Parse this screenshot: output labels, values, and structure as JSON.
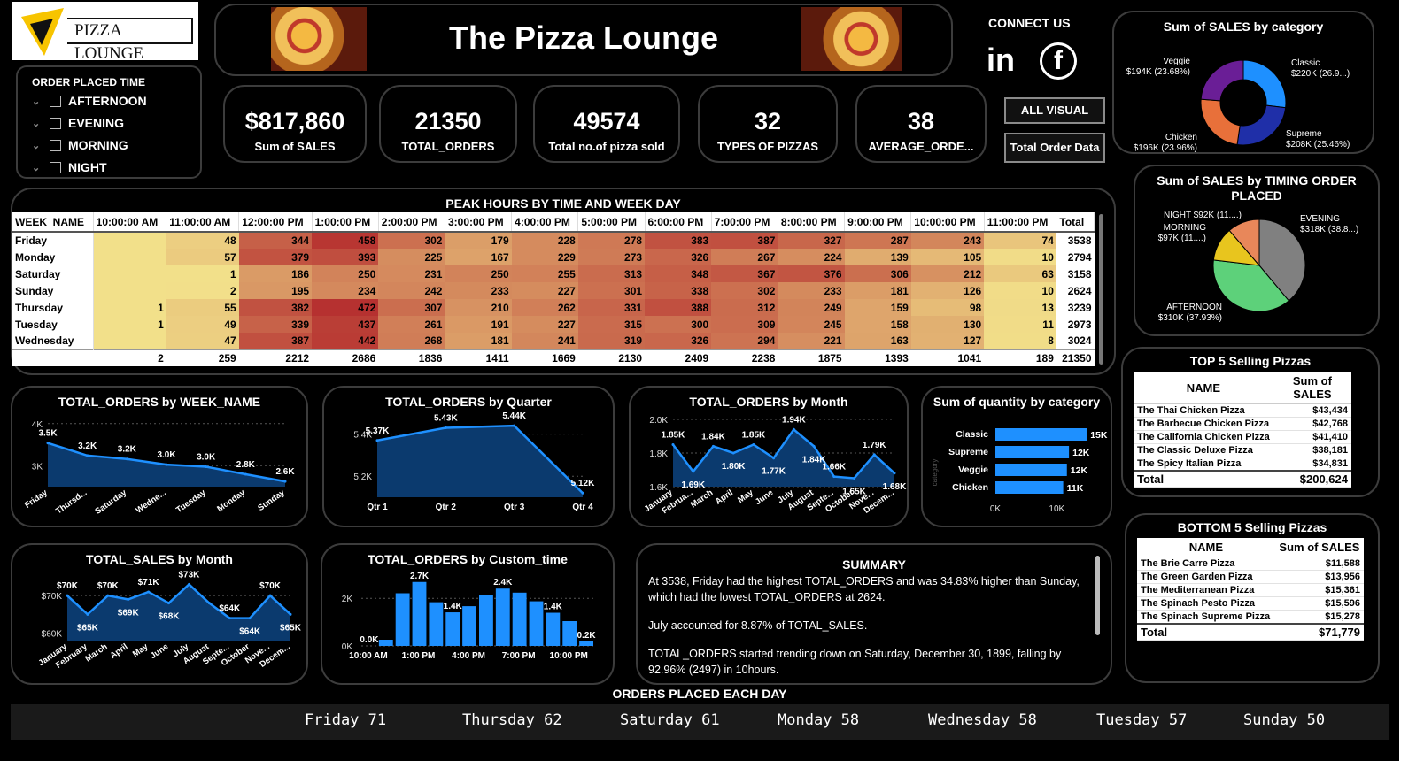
{
  "brand": {
    "logo_text": "PIZZA LOUNGE",
    "title": "The Pizza Lounge"
  },
  "connect": {
    "label": "CONNECT  US",
    "linkedin": "in",
    "facebook": "f"
  },
  "slicer": {
    "title": "ORDER PLACED TIME",
    "items": [
      "AFTERNOON",
      "EVENING",
      "MORNING",
      "NIGHT"
    ]
  },
  "kpis": [
    {
      "value": "$817,860",
      "label": "Sum of SALES"
    },
    {
      "value": "21350",
      "label": "TOTAL_ORDERS"
    },
    {
      "value": "49574",
      "label": "Total no.of pizza sold"
    },
    {
      "value": "32",
      "label": "TYPES OF PIZZAS"
    },
    {
      "value": "38",
      "label": "AVERAGE_ORDE..."
    }
  ],
  "buttons": {
    "all_visual": "ALL VISUAL",
    "total_order_data": "Total Order Data"
  },
  "matrix": {
    "title": "PEAK HOURS BY TIME AND WEEK DAY",
    "columns": [
      "WEEK_NAME",
      "10:00:00 AM",
      "11:00:00 AM",
      "12:00:00 PM",
      "1:00:00 PM",
      "2:00:00 PM",
      "3:00:00 PM",
      "4:00:00 PM",
      "5:00:00 PM",
      "6:00:00 PM",
      "7:00:00 PM",
      "8:00:00 PM",
      "9:00:00 PM",
      "10:00:00 PM",
      "11:00:00 PM",
      "Total"
    ],
    "rows": [
      [
        "Friday",
        "",
        "48",
        "344",
        "458",
        "302",
        "179",
        "228",
        "278",
        "383",
        "387",
        "327",
        "287",
        "243",
        "74",
        "3538"
      ],
      [
        "Monday",
        "",
        "57",
        "379",
        "393",
        "225",
        "167",
        "229",
        "273",
        "326",
        "267",
        "224",
        "139",
        "105",
        "10",
        "2794"
      ],
      [
        "Saturday",
        "",
        "1",
        "186",
        "250",
        "231",
        "250",
        "255",
        "313",
        "348",
        "367",
        "376",
        "306",
        "212",
        "63",
        "3158"
      ],
      [
        "Sunday",
        "",
        "2",
        "195",
        "234",
        "242",
        "233",
        "227",
        "301",
        "338",
        "302",
        "233",
        "181",
        "126",
        "10",
        "2624"
      ],
      [
        "Thursday",
        "1",
        "55",
        "382",
        "472",
        "307",
        "210",
        "262",
        "331",
        "388",
        "312",
        "249",
        "159",
        "98",
        "13",
        "3239"
      ],
      [
        "Tuesday",
        "1",
        "49",
        "339",
        "437",
        "261",
        "191",
        "227",
        "315",
        "300",
        "309",
        "245",
        "158",
        "130",
        "11",
        "2973"
      ],
      [
        "Wednesday",
        "",
        "47",
        "387",
        "442",
        "268",
        "181",
        "241",
        "319",
        "326",
        "294",
        "221",
        "163",
        "127",
        "8",
        "3024"
      ]
    ],
    "totals": [
      "",
      "2",
      "259",
      "2212",
      "2686",
      "1836",
      "1411",
      "1669",
      "2130",
      "2409",
      "2238",
      "1875",
      "1393",
      "1041",
      "189",
      "21350"
    ]
  },
  "charts": {
    "category_donut": {
      "title": "Sum of SALES by category",
      "type": "pie",
      "slices": [
        {
          "name": "Classic",
          "value": 220,
          "label": "Classic",
          "sub": "$220K (26.9...)",
          "color": "#1e90ff"
        },
        {
          "name": "Supreme",
          "value": 208,
          "label": "Supreme",
          "sub": "$208K (25.46%)",
          "color": "#1f2fa8"
        },
        {
          "name": "Chicken",
          "value": 196,
          "label": "Chicken",
          "sub": "$196K (23.96%)",
          "color": "#e8703a"
        },
        {
          "name": "Veggie",
          "value": 194,
          "label": "Veggie",
          "sub": "$194K (23.68%)",
          "color": "#6a1e96"
        }
      ]
    },
    "timing_pie": {
      "title": "Sum of SALES by TIMING ORDER PLACED",
      "type": "pie",
      "slices": [
        {
          "name": "EVENING",
          "value": 318,
          "label": "EVENING",
          "sub": "$318K (38.8...)",
          "color": "#808080"
        },
        {
          "name": "AFTERNOON",
          "value": 310,
          "label": "AFTERNOON",
          "sub": "$310K (37.93%)",
          "color": "#5dd17a"
        },
        {
          "name": "MORNING",
          "value": 97,
          "label": "MORNING",
          "sub": "$97K (11....)",
          "color": "#e8c51e"
        },
        {
          "name": "NIGHT",
          "value": 92,
          "label": "NIGHT $92K (11....)",
          "sub": "",
          "color": "#e8875a"
        }
      ]
    },
    "orders_week": {
      "title": "TOTAL_ORDERS by WEEK_NAME",
      "type": "area",
      "x": [
        "Friday",
        "Thursd...",
        "Saturday",
        "Wedne...",
        "Tuesday",
        "Monday",
        "Sunday"
      ],
      "y": [
        3538,
        3239,
        3158,
        3024,
        2973,
        2794,
        2624
      ],
      "labels": [
        "3.5K",
        "3.2K",
        "3.2K",
        "3.0K",
        "3.0K",
        "2.8K",
        "2.6K"
      ],
      "yticks": [
        "4K",
        "3K"
      ],
      "tickvals": [
        4000,
        3000
      ],
      "ylim": [
        2500,
        4100
      ]
    },
    "orders_quarter": {
      "title": "TOTAL_ORDERS by Quarter",
      "type": "area",
      "x": [
        "Qtr 1",
        "Qtr 2",
        "Qtr 3",
        "Qtr 4"
      ],
      "y": [
        5370,
        5430,
        5440,
        5120
      ],
      "labels": [
        "5.37K",
        "5.43K",
        "5.44K",
        "5.12K"
      ],
      "yticks": [
        "5.4K",
        "5.2K"
      ],
      "tickvals": [
        5400,
        5200
      ],
      "ylim": [
        5100,
        5470
      ]
    },
    "orders_month": {
      "title": "TOTAL_ORDERS by Month",
      "type": "area",
      "x": [
        "January",
        "Februa...",
        "March",
        "April",
        "May",
        "June",
        "July",
        "August",
        "Septe...",
        "October",
        "Nove...",
        "Decem..."
      ],
      "y": [
        1850,
        1690,
        1840,
        1800,
        1850,
        1770,
        1940,
        1840,
        1660,
        1650,
        1790,
        1680
      ],
      "labels": [
        "1.85K",
        "1.69K",
        "1.84K",
        "1.80K",
        "1.85K",
        "1.77K",
        "1.94K",
        "1.84K",
        "1.66K",
        "1.65K",
        "1.79K",
        "1.68K"
      ],
      "yticks": [
        "2.0K",
        "1.8K",
        "1.6K"
      ],
      "tickvals": [
        2000,
        1800,
        1600
      ],
      "ylim": [
        1600,
        2000
      ]
    },
    "qty_category": {
      "title": "Sum of quantity by category",
      "type": "bar",
      "categories": [
        "Classic",
        "Supreme",
        "Veggie",
        "Chicken"
      ],
      "values": [
        14888,
        11987,
        11649,
        11050
      ],
      "labels": [
        "15K",
        "12K",
        "12K",
        "11K"
      ],
      "xticks": [
        "0K",
        "10K"
      ],
      "axis_label": "category"
    },
    "sales_month": {
      "title": "TOTAL_SALES by Month",
      "type": "area",
      "x": [
        "January",
        "February",
        "March",
        "April",
        "May",
        "June",
        "July",
        "August",
        "Septe...",
        "October",
        "Nove...",
        "Decem..."
      ],
      "y": [
        70,
        65,
        70,
        69,
        71,
        68,
        73,
        68,
        64,
        64,
        70,
        65
      ],
      "labels": [
        "$70K",
        "$65K",
        "$70K",
        "$69K",
        "$71K",
        "$68K",
        "$73K",
        "",
        "$64K",
        "$64K",
        "$70K",
        "$65K"
      ],
      "yticks": [
        "$70K",
        "$60K"
      ],
      "tickvals": [
        70,
        60
      ],
      "ylim": [
        58,
        75
      ]
    },
    "orders_custom": {
      "title": "TOTAL_ORDERS by Custom_time",
      "type": "bar",
      "x": [
        "10:00 AM",
        "1:00 PM",
        "4:00 PM",
        "7:00 PM",
        "10:00 PM"
      ],
      "values": [
        0,
        260,
        2212,
        2686,
        1836,
        1411,
        1669,
        2130,
        2409,
        2238,
        1875,
        1393,
        1041,
        189
      ],
      "labels": {
        "0": "0.0K",
        "3": "2.7K",
        "5": "1.4K",
        "8": "2.4K",
        "11": "1.4K",
        "13": "0.2K"
      },
      "yticks": [
        "2K",
        "0K"
      ],
      "tickvals": [
        2000,
        0
      ],
      "ylim": [
        0,
        2900
      ]
    }
  },
  "top5": {
    "title": "TOP 5 Selling Pizzas",
    "col1": "NAME",
    "col2": "Sum of SALES",
    "rows": [
      [
        "The Thai Chicken Pizza",
        "$43,434"
      ],
      [
        "The Barbecue Chicken Pizza",
        "$42,768"
      ],
      [
        "The California Chicken Pizza",
        "$41,410"
      ],
      [
        "The Classic Deluxe Pizza",
        "$38,181"
      ],
      [
        "The Spicy Italian Pizza",
        "$34,831"
      ]
    ],
    "total_label": "Total",
    "total": "$200,624"
  },
  "bottom5": {
    "title": "BOTTOM 5 Selling Pizzas",
    "col1": "NAME",
    "col2": "Sum of SALES",
    "rows": [
      [
        "The Brie Carre Pizza",
        "$11,588"
      ],
      [
        "The Green Garden Pizza",
        "$13,956"
      ],
      [
        "The Mediterranean Pizza",
        "$15,361"
      ],
      [
        "The Spinach Pesto Pizza",
        "$15,596"
      ],
      [
        "The Spinach Supreme Pizza",
        "$15,278"
      ]
    ],
    "total_label": "Total",
    "total": "$71,779"
  },
  "summary": {
    "title": "SUMMARY",
    "p1": "At 3538, Friday had the highest TOTAL_ORDERS and was 34.83% higher than Sunday, which had the lowest TOTAL_ORDERS at 2624.",
    "p2": "July accounted for 8.87% of TOTAL_SALES.",
    "p3": "TOTAL_ORDERS started trending down on Saturday, December 30, 1899, falling by 92.96% (2497) in 10hours."
  },
  "ticker": {
    "title": "ORDERS PLACED EACH DAY",
    "items": [
      "Friday 71",
      "Thursday 62",
      "Saturday 61",
      "Monday 58",
      "Wednesday 58",
      "Tuesday 57",
      "Sunday 50"
    ]
  },
  "colors": {
    "accent": "#1e90ff",
    "area_fill": "#0b3a6e",
    "heat_low": "#f2e08a",
    "heat_high": "#b52e2e"
  }
}
